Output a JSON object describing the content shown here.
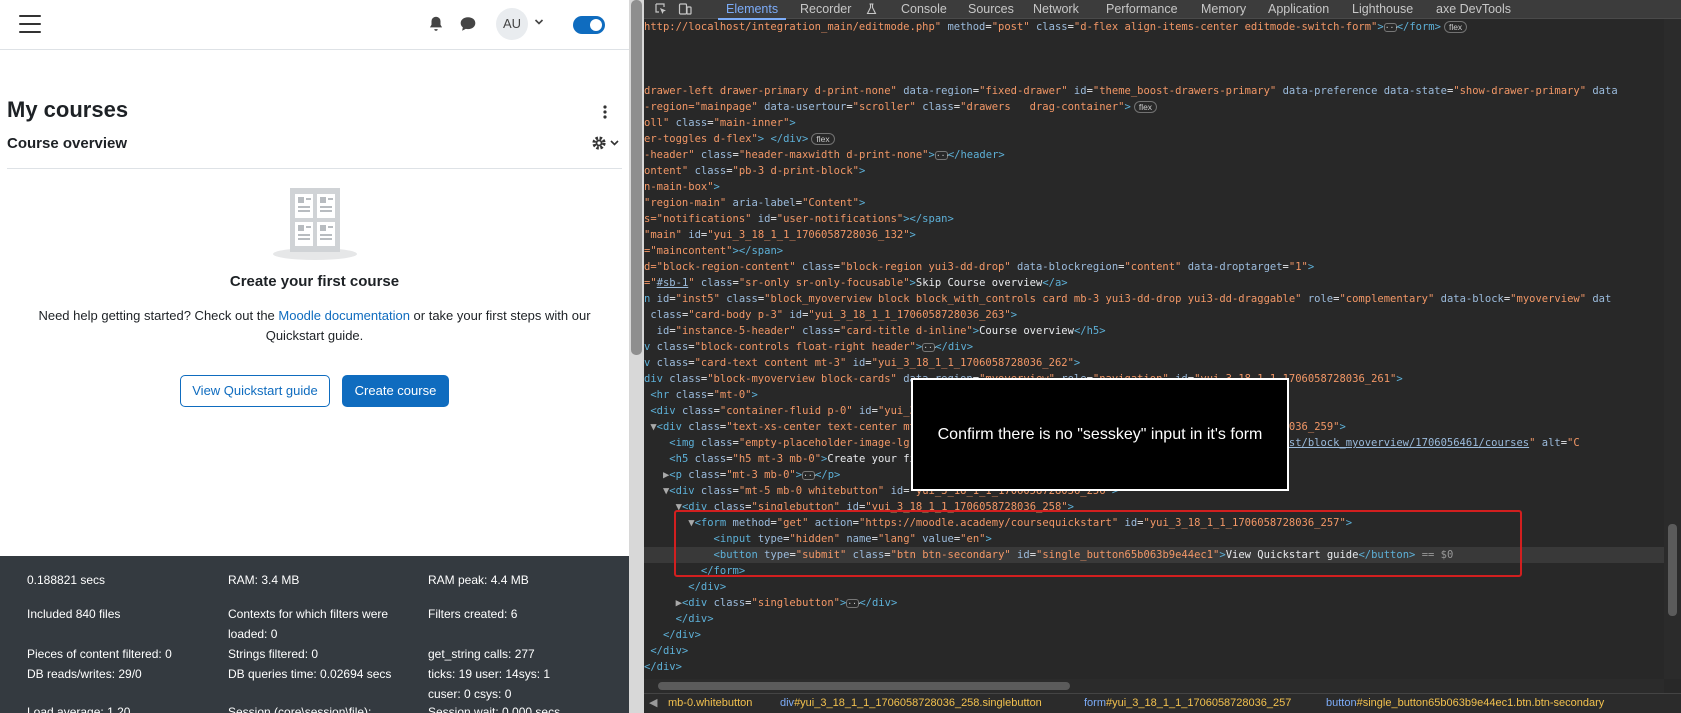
{
  "moodle": {
    "avatar_initials": "AU",
    "page_title": "My courses",
    "block_title": "Course overview",
    "empty_title": "Create your first course",
    "empty_text_before": "Need help getting started? Check out the ",
    "empty_text_link": "Moodle documentation",
    "empty_text_after": " or take your first steps with our Quickstart guide.",
    "quickstart_button": "View Quickstart guide",
    "create_button": "Create course",
    "accent_color": "#0f6cbf",
    "perf": [
      {
        "text": "0.188821 secs"
      },
      {
        "text": "RAM: 3.4 MB"
      },
      {
        "text": "RAM peak: 4.4 MB"
      },
      {
        "text": "Included 840 files"
      },
      {
        "text": "Contexts for which filters were loaded: 0"
      },
      {
        "text": "Filters created: 6"
      },
      {
        "text": "Pieces of content filtered: 0"
      },
      {
        "text": "Strings filtered: 0"
      },
      {
        "text": "get_string calls: 277"
      },
      {
        "text": "DB reads/writes: 29/0"
      },
      {
        "text": "DB queries time: 0.02694 secs"
      },
      {
        "text": "ticks: 19 user: 14sys: 1"
      },
      {
        "text": "cuser: 0 csys: 0"
      },
      {
        "text": "Load average: 1.20"
      },
      {
        "text": "Session (core\\session\\file):"
      },
      {
        "text": "Session wait: 0.000 secs"
      }
    ]
  },
  "devtools": {
    "tabs": [
      "Elements",
      "Recorder",
      "Console",
      "Sources",
      "Network",
      "Performance",
      "Memory",
      "Application",
      "Lighthouse",
      "axe DevTools"
    ],
    "active_tab": "Elements",
    "accent_color": "#7cacf8",
    "breadcrumbs": [
      {
        "tag": "",
        "rest": "mb-0.whitebutton"
      },
      {
        "tag": "div",
        "rest": "#yui_3_18_1_1_1706058728036_258.singlebutton"
      },
      {
        "tag": "form",
        "rest": "#yui_3_18_1_1_1706058728036_257"
      },
      {
        "tag": "button",
        "rest": "#single_button65b063b9e44ec1.btn.btn-secondary"
      }
    ],
    "caption": "Confirm there is no \"sesskey\" input in it's form",
    "highlight_color": "#d21f1f"
  }
}
